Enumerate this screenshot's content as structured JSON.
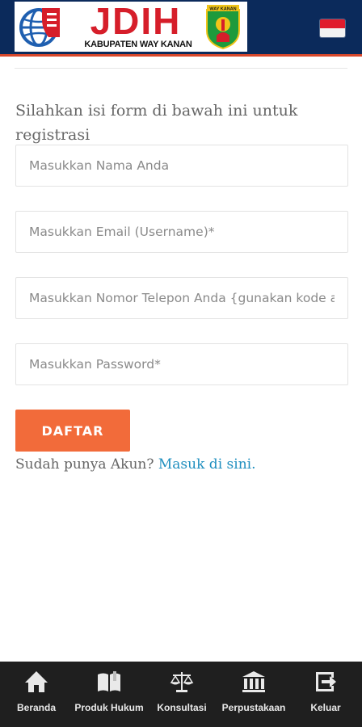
{
  "header": {
    "logo_title": "JDIH",
    "logo_subtitle": "KABUPATEN WAY KANAN",
    "emblem_text": "WAY KANAN",
    "language_flag": "indonesia-flag-icon",
    "colors": {
      "header_bg": "#0b2a5b",
      "header_border": "#d9482b",
      "logo_red": "#d61e2a"
    }
  },
  "form": {
    "intro": "Silahkan isi form di bawah ini untuk registrasi",
    "name_placeholder": "Masukkan Nama Anda",
    "email_placeholder": "Masukkan Email (Username)*",
    "phone_placeholder": "Masukkan Nomor Telepon Anda {gunakan kode ar",
    "password_placeholder": "Masukkan Password*",
    "submit_label": "DAFTAR",
    "submit_color": "#f26b3a",
    "login_prompt": "Sudah punya Akun?",
    "login_link": "Masuk di sini.",
    "link_color": "#1f8fbf"
  },
  "bottom_nav": {
    "items": [
      {
        "label": "Beranda",
        "icon": "home-icon"
      },
      {
        "label": "Produk Hukum",
        "icon": "book-icon"
      },
      {
        "label": "Konsultasi",
        "icon": "scale-icon"
      },
      {
        "label": "Perpustakaan",
        "icon": "library-icon"
      },
      {
        "label": "Keluar",
        "icon": "logout-icon"
      }
    ]
  }
}
